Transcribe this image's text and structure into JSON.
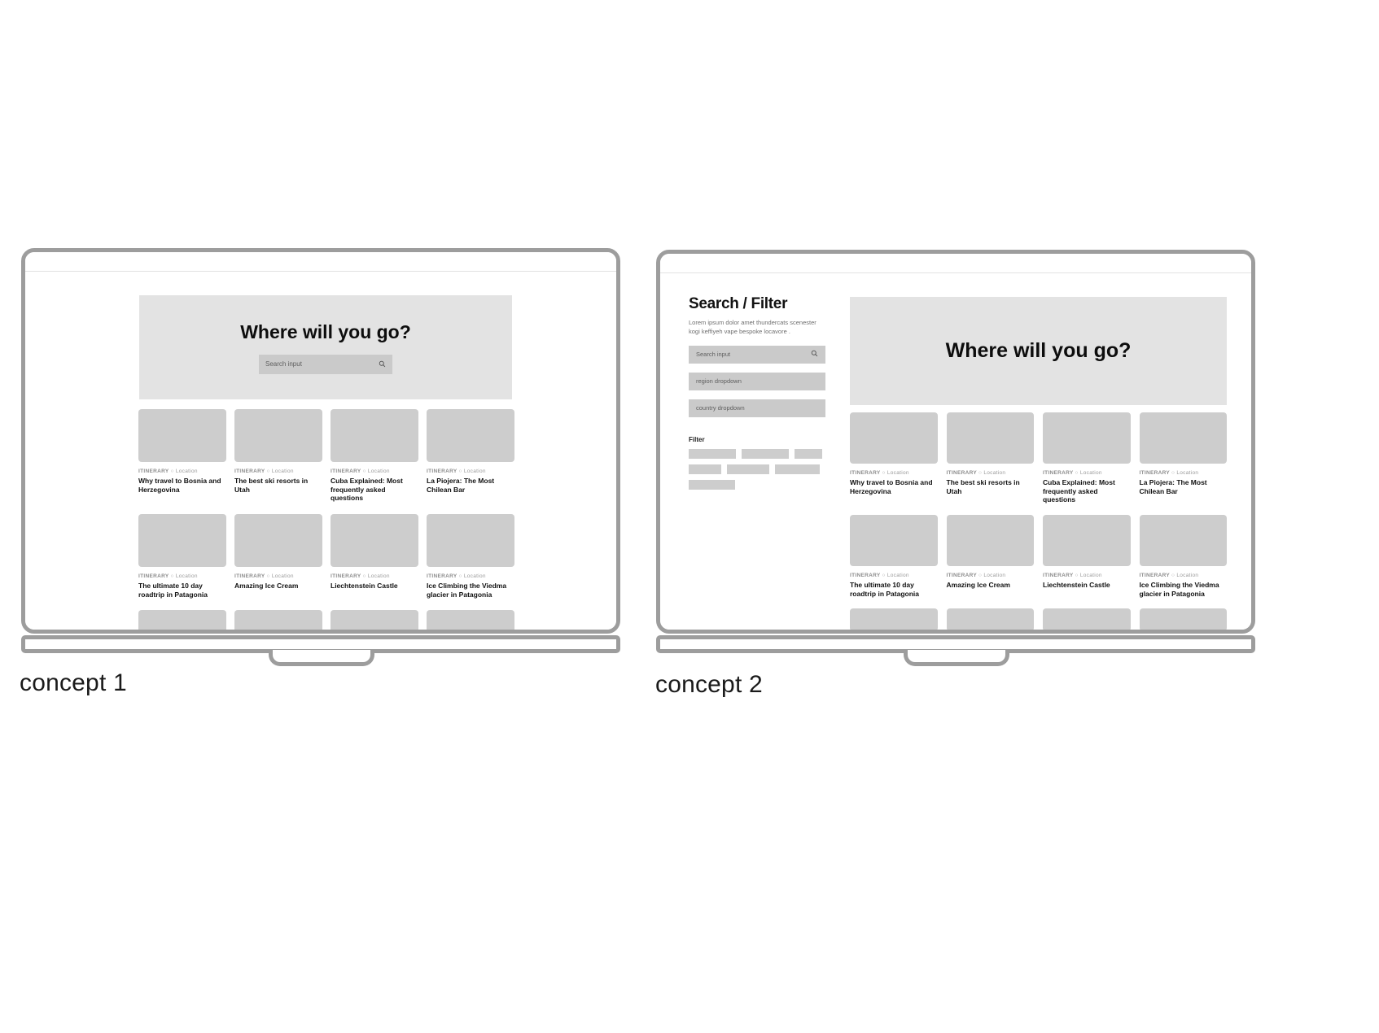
{
  "page": {
    "background": "#ffffff",
    "accent_gray": "#cdcdcd",
    "hero_bg": "#e3e3e3",
    "chrome_color": "#9d9d9d"
  },
  "concepts": [
    {
      "caption": "concept 1",
      "layout": "centered-hero"
    },
    {
      "caption": "concept 2",
      "layout": "sidebar-filter"
    }
  ],
  "hero": {
    "title": "Where will you go?",
    "search_placeholder": "Search input",
    "search_icon": "magnifier-icon"
  },
  "sidebar": {
    "title": "Search / Filter",
    "subtitle": "Lorem ipsum dolor amet thundercats scenester kogi keffiyeh vape bespoke locavore .",
    "search_placeholder": "Search input",
    "search_icon": "magnifier-icon",
    "region_dropdown": "region dropdown",
    "country_dropdown": "country dropdown",
    "filter_label": "Filter",
    "chip_rows": [
      [
        58,
        58,
        34
      ],
      [
        40,
        52,
        55
      ],
      [
        57
      ]
    ]
  },
  "cards": {
    "eyebrow_label": "ITINERARY",
    "eyebrow_separator": "○",
    "eyebrow_location": "Location",
    "row1": [
      {
        "title": "Why travel to Bosnia and Herzegovina"
      },
      {
        "title": "The best ski resorts in Utah"
      },
      {
        "title": "Cuba Explained: Most frequently asked questions"
      },
      {
        "title": "La Piojera: The Most Chilean Bar"
      }
    ],
    "row2": [
      {
        "title": "The ultimate 10 day roadtrip in Patagonia"
      },
      {
        "title": "Amazing Ice Cream"
      },
      {
        "title": "Liechtenstein Castle"
      },
      {
        "title": "Ice Climbing the Viedma glacier in Patagonia"
      }
    ],
    "row3_placeholder_count": 4
  }
}
